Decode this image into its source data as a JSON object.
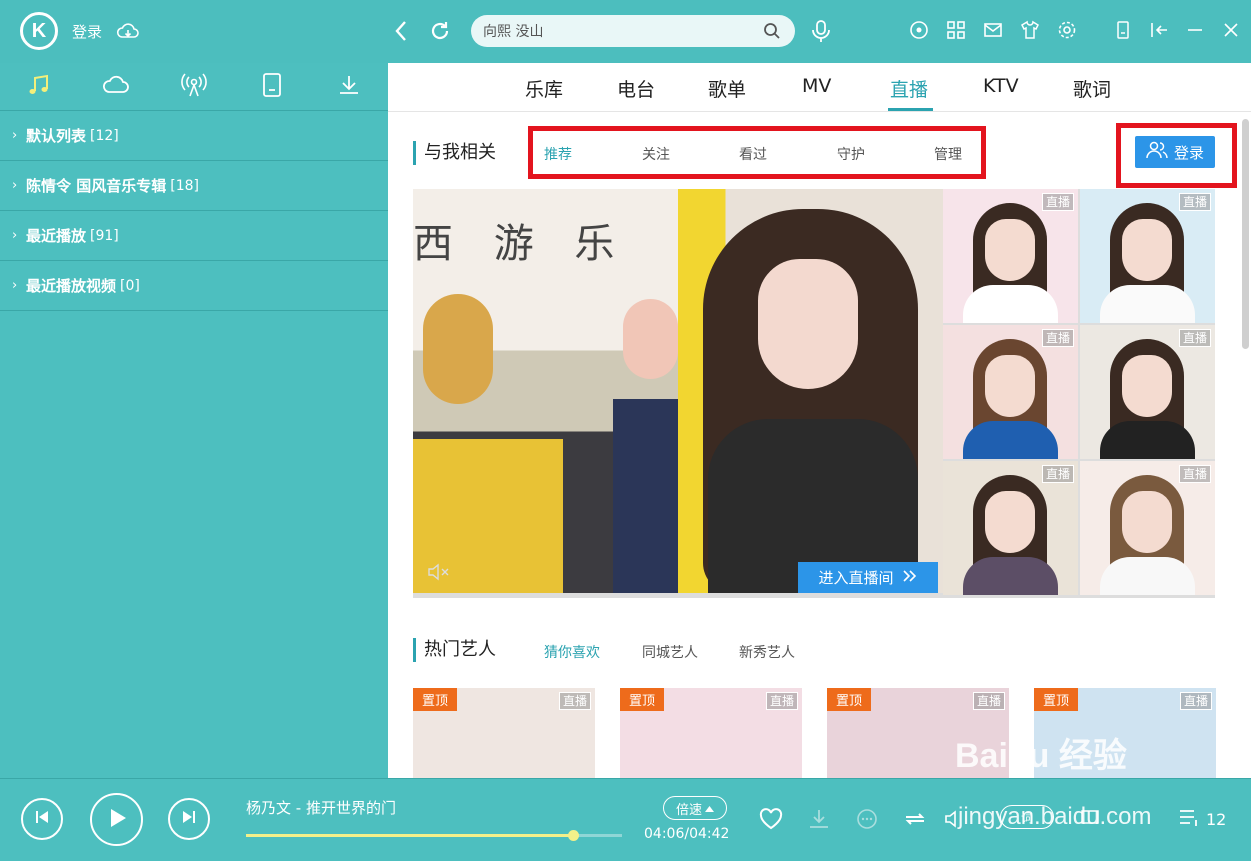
{
  "header": {
    "logo": "K",
    "login_label": "登录",
    "search": {
      "value": "向熙 没山"
    }
  },
  "sidebar": {
    "tabs": [
      "music-note-icon",
      "cloud-icon",
      "radio-icon",
      "device-icon",
      "download-icon"
    ],
    "playlists": [
      {
        "name": "默认列表",
        "count": "[12]"
      },
      {
        "name": "陈情令 国风音乐专辑",
        "count": "[18]"
      },
      {
        "name": "最近播放",
        "count": "[91]"
      },
      {
        "name": "最近播放视频",
        "count": "[0]"
      }
    ]
  },
  "main": {
    "tabs": [
      "乐库",
      "电台",
      "歌单",
      "MV",
      "直播",
      "KTV",
      "歌词"
    ],
    "active_tab": "直播",
    "section1": {
      "title": "与我相关",
      "subtabs": [
        "推荐",
        "关注",
        "看过",
        "守护",
        "管理"
      ],
      "login_button": "登录",
      "enter_live": "进入直播间",
      "live_badge": "直播",
      "banner_text": "西 游 乐"
    },
    "section2": {
      "title": "热门艺人",
      "subtabs": [
        "猜你喜欢",
        "同城艺人",
        "新秀艺人"
      ],
      "pin_label": "置顶",
      "live_badge": "直播"
    }
  },
  "player": {
    "song": "杨乃文 - 推开世界的门",
    "speed_label": "倍速",
    "time": "04:06/04:42",
    "progress": 0.87,
    "lyric_label": "词",
    "queue_count": "12"
  },
  "watermark": {
    "brand": "Baidu 经验",
    "url": "jingyan.baidu.com"
  },
  "colors": {
    "accent": "#2ba3b0",
    "sidebar": "#4dbfbf",
    "highlight_box": "#e3141e",
    "blue_button": "#2c95e8",
    "pin": "#ee6b1b"
  }
}
